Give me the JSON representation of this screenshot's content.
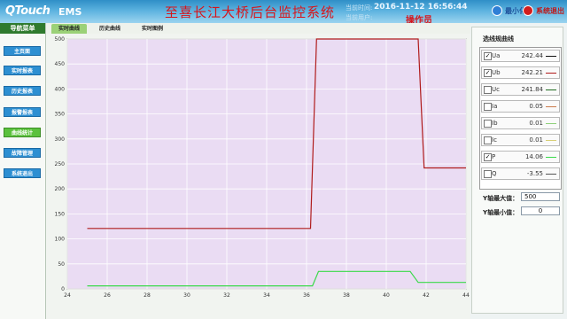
{
  "header": {
    "logo": "QTouch",
    "product": "EMS",
    "title": "至喜长江大桥后台监控系统",
    "time_label": "当前时间:",
    "time_value": "2016-11-12 16:56:44",
    "user_label": "当前用户:",
    "operator": "操作员",
    "minimize_label": "最小化",
    "exit_label": "系统退出"
  },
  "sidebar": {
    "heading": "导航菜单",
    "items": [
      {
        "label": "主页面"
      },
      {
        "label": "实时报表"
      },
      {
        "label": "历史报表"
      },
      {
        "label": "报警报表"
      },
      {
        "label": "曲线统计",
        "active": true
      },
      {
        "label": "故障管理"
      },
      {
        "label": "系统退出"
      }
    ]
  },
  "tabs": [
    {
      "label": "实时曲线",
      "active": true
    },
    {
      "label": "历史曲线"
    },
    {
      "label": "实时图例"
    }
  ],
  "right_panel": {
    "title": "选线规曲线",
    "legend": [
      {
        "name": "Ua",
        "value": "242.44",
        "checked": true,
        "color": "#111111"
      },
      {
        "name": "Ub",
        "value": "242.21",
        "checked": true,
        "color": "#b01c1c"
      },
      {
        "name": "Uc",
        "value": "241.84",
        "checked": false,
        "color": "#1f6b1f"
      },
      {
        "name": "Ia",
        "value": "0.05",
        "checked": false,
        "color": "#c97a4a"
      },
      {
        "name": "Ib",
        "value": "0.01",
        "checked": false,
        "color": "#8fd07a"
      },
      {
        "name": "Ic",
        "value": "0.01",
        "checked": false,
        "color": "#d8cf76"
      },
      {
        "name": "P",
        "value": "14.06",
        "checked": true,
        "color": "#3ad94a"
      },
      {
        "name": "Q",
        "value": "-3.55",
        "checked": false,
        "color": "#555555"
      }
    ],
    "ymax_label": "Y轴最大值：",
    "ymax_value": "500",
    "ymin_label": "Y轴最小值：",
    "ymin_value": "0"
  },
  "chart_data": {
    "type": "line",
    "xlim": [
      24,
      44
    ],
    "ylim": [
      0,
      500
    ],
    "xticks": [
      24,
      26,
      28,
      30,
      32,
      34,
      36,
      38,
      40,
      42,
      44
    ],
    "yticks": [
      0,
      50,
      100,
      150,
      200,
      250,
      300,
      350,
      400,
      450,
      500
    ],
    "grid": true,
    "background": "#eadcf3",
    "series": [
      {
        "name": "Ub",
        "color": "#b01c1c",
        "points": [
          [
            25,
            121
          ],
          [
            36.2,
            121
          ],
          [
            36.5,
            500
          ],
          [
            41.6,
            500
          ],
          [
            41.9,
            242
          ],
          [
            44,
            242
          ]
        ]
      },
      {
        "name": "P",
        "color": "#3ad94a",
        "points": [
          [
            25,
            6
          ],
          [
            36.3,
            6
          ],
          [
            36.6,
            35
          ],
          [
            41.2,
            35
          ],
          [
            41.6,
            13
          ],
          [
            44,
            13
          ]
        ]
      }
    ]
  }
}
